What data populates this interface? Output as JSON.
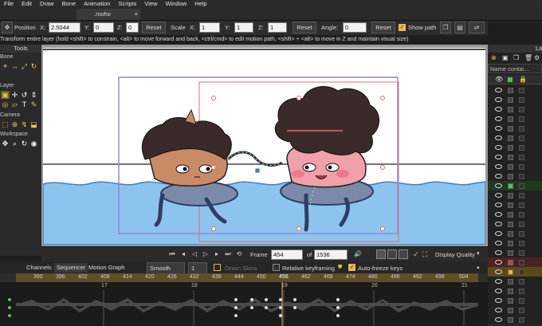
{
  "menu": [
    "File",
    "Edit",
    "Draw",
    "Bone",
    "Animation",
    "Scripts",
    "View",
    "Window",
    "Help"
  ],
  "doc_tab": {
    "label": ".moho",
    "close": "×"
  },
  "toolbar": {
    "position_label": "Position",
    "x_label": "X:",
    "x_value": "2.5044",
    "y_label": "Y:",
    "y_value": "0",
    "z_label": "Z:",
    "z_value": "0",
    "reset1": "Reset",
    "scale_label": "Scale",
    "sx_label": "X:",
    "sx_value": "1",
    "sy_label": "Y:",
    "sy_value": "1",
    "sz_label": "Z:",
    "sz_value": "1",
    "reset2": "Reset",
    "angle_label": "Angle:",
    "angle_value": "0",
    "reset3": "Reset",
    "show_path_label": "Show path",
    "show_path_checked": true
  },
  "hint": "Transform entire layer (hold <shift> to constrain, <alt> to move forward and back, <ctrl/cmd> to edit motion path, <shift> + <alt> to move in Z and maintain visual size)",
  "tools": {
    "title": "Tools",
    "sections": [
      "Bone",
      "Layer",
      "Camera",
      "Workspace"
    ]
  },
  "viewbar": {
    "frame_label": "Frame",
    "frame_value": "454",
    "of_label": "of",
    "total_value": "1536",
    "display_quality": "Display Quality"
  },
  "timeline": {
    "tabs": [
      "Channels",
      "Sequencer",
      "Motion Graph"
    ],
    "interp": "Smooth",
    "interp_count": "1",
    "onion_skins": "Onion Skins",
    "relative_keyframing": "Relative keyframing",
    "auto_freeze": "Auto-freeze keys",
    "ruler": [
      "390",
      "396",
      "402",
      "408",
      "414",
      "420",
      "426",
      "432",
      "438",
      "444",
      "450",
      "456",
      "462",
      "468",
      "474",
      "480",
      "486",
      "492",
      "498",
      "504"
    ],
    "markers": [
      "17",
      "18",
      "19",
      "20",
      "21"
    ]
  },
  "layers": {
    "title": "Layers",
    "filter_placeholder": "Name contai..."
  },
  "colors": {
    "accent": "#e8b84a",
    "water": "#8cc4ee",
    "water_edge": "#3b7fcf",
    "hair": "#3a2a2a",
    "skin_left": "#c98a66",
    "skin_right": "#f0a0a8",
    "float": "#7a8aa8",
    "selection": "#e86a6a",
    "camera": "#8a8ad8"
  }
}
